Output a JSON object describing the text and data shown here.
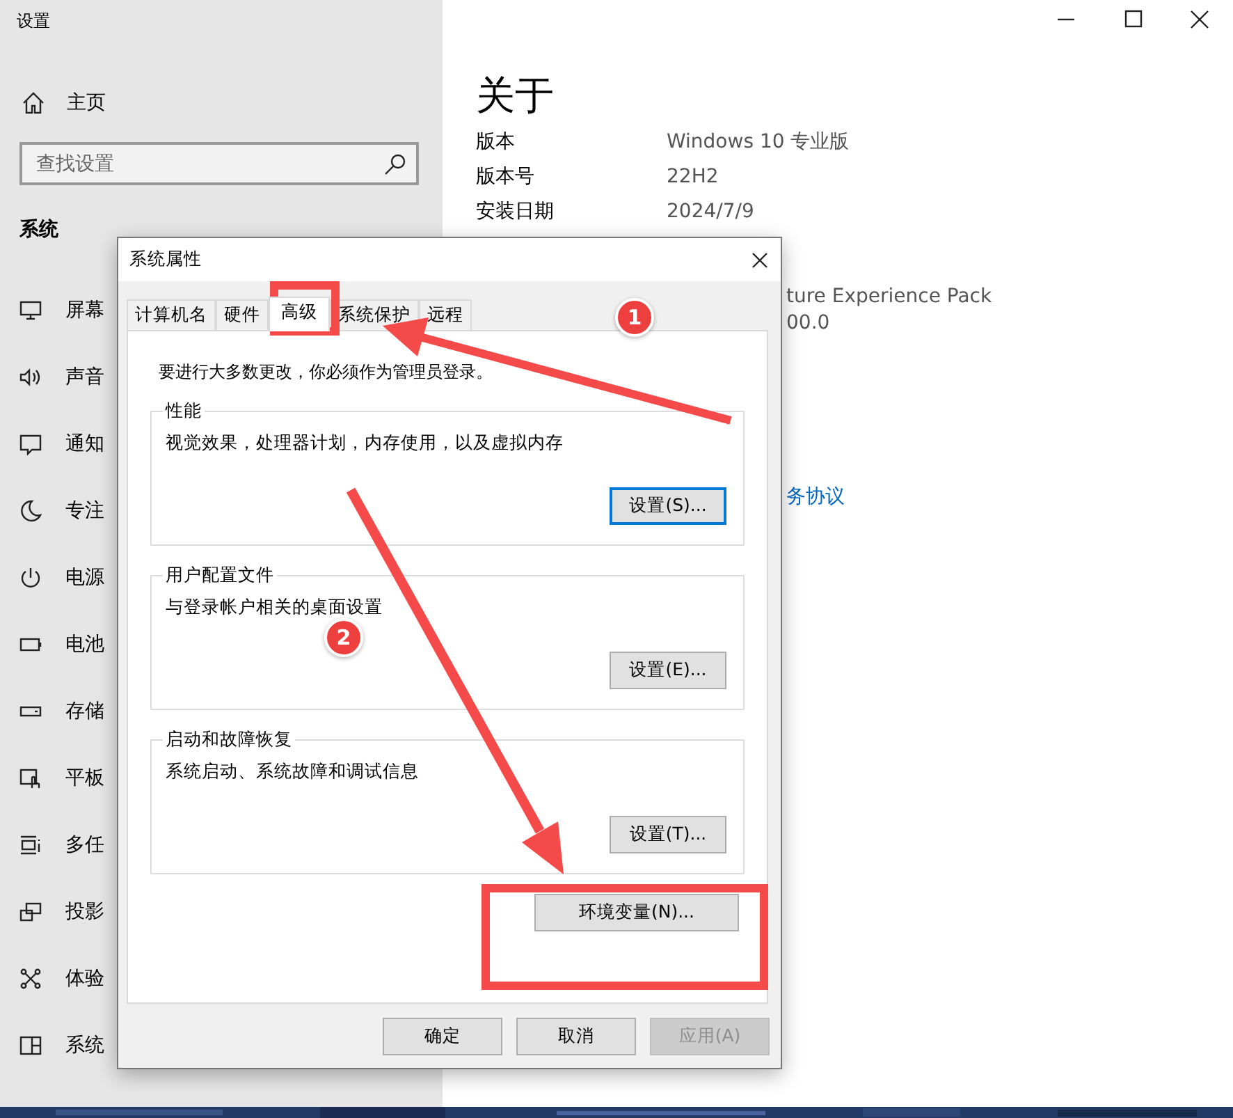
{
  "settings": {
    "title": "设置",
    "home": "主页",
    "search": {
      "placeholder": "查找设置"
    },
    "section": "系统",
    "items": [
      {
        "label": "屏幕"
      },
      {
        "label": "声音"
      },
      {
        "label": "通知"
      },
      {
        "label": "专注"
      },
      {
        "label": "电源"
      },
      {
        "label": "电池"
      },
      {
        "label": "存储"
      },
      {
        "label": "平板"
      },
      {
        "label": "多任"
      },
      {
        "label": "投影"
      },
      {
        "label": "体验"
      },
      {
        "label": "系统"
      }
    ]
  },
  "about": {
    "heading": "关于",
    "rows": [
      {
        "label": "版本",
        "value": "Windows 10 专业版"
      },
      {
        "label": "版本号",
        "value": "22H2"
      },
      {
        "label": "安装日期",
        "value": "2024/7/9"
      }
    ],
    "fragments": [
      "ture Experience Pack",
      "00.0"
    ],
    "link": "务协议"
  },
  "dialog": {
    "title": "系统属性",
    "tabs": [
      {
        "label": "计算机名",
        "selected": false
      },
      {
        "label": "硬件",
        "selected": false
      },
      {
        "label": "高级",
        "selected": true
      },
      {
        "label": "系统保护",
        "selected": false
      },
      {
        "label": "远程",
        "selected": false
      }
    ],
    "notice": "要进行大多数更改，你必须作为管理员登录。",
    "groups": [
      {
        "legend": "性能",
        "description": "视觉效果，处理器计划，内存使用，以及虚拟内存",
        "button": "设置(S)...",
        "focused": true
      },
      {
        "legend": "用户配置文件",
        "description": "与登录帐户相关的桌面设置",
        "button": "设置(E)...",
        "focused": false
      },
      {
        "legend": "启动和故障恢复",
        "description": "系统启动、系统故障和调试信息",
        "button": "设置(T)...",
        "focused": false
      }
    ],
    "env_button": "环境变量(N)...",
    "buttons": [
      {
        "label": "确定",
        "disabled": false
      },
      {
        "label": "取消",
        "disabled": false
      },
      {
        "label": "应用(A)",
        "disabled": true
      }
    ]
  },
  "annotations": {
    "badges": [
      "1",
      "2"
    ]
  }
}
